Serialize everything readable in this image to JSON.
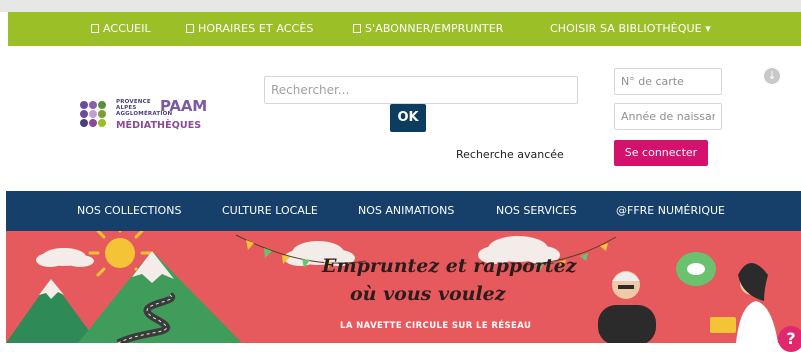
{
  "topnav": {
    "items": [
      {
        "label": "ACCUEIL",
        "icon": "square-icon"
      },
      {
        "label": "HORAIRES ET ACCÈS",
        "icon": "square-icon"
      },
      {
        "label": "S'ABONNER/EMPRUNTER",
        "icon": "square-icon"
      },
      {
        "label": "CHOISIR SA BIBLIOTHÈQUE ▾"
      }
    ]
  },
  "logo": {
    "small_text": [
      "PROVENCE",
      "ALPES",
      "AGGLOMÉRATION"
    ],
    "brand": "PAAM",
    "name": "MÉDIATHÈQUES",
    "dot_colors": [
      "#6b4c9a",
      "#8a5ea8",
      "#5d8f3b",
      "#6b4c9a",
      "#c0a0d0",
      "#7a9d3a",
      "#4a3d7a",
      "#8a4a96",
      "#9bbf27"
    ]
  },
  "search": {
    "placeholder": "Rechercher...",
    "submit_label": "OK",
    "advanced_label": "Recherche avancée"
  },
  "login": {
    "card_placeholder": "N° de carte",
    "birth_placeholder": "Année de naissar",
    "connect_label": "Se connecter"
  },
  "mainnav": {
    "items": [
      "NOS COLLECTIONS",
      "CULTURE LOCALE",
      "NOS ANIMATIONS",
      "NOS SERVICES",
      "@FFRE NUMÉRIQUE"
    ]
  },
  "banner": {
    "line1": "Empruntez et rapportez",
    "line2": "où vous voulez",
    "subline": "LA NAVETTE CIRCULE SUR LE RÉSEAU"
  },
  "help": {
    "label": "?"
  },
  "colors": {
    "topnav_bg": "#9bbf27",
    "mainnav_bg": "#16406a",
    "ok_bg": "#0c3c5e",
    "connect_bg": "#d5116e",
    "banner_bg": "#e65a5d"
  }
}
